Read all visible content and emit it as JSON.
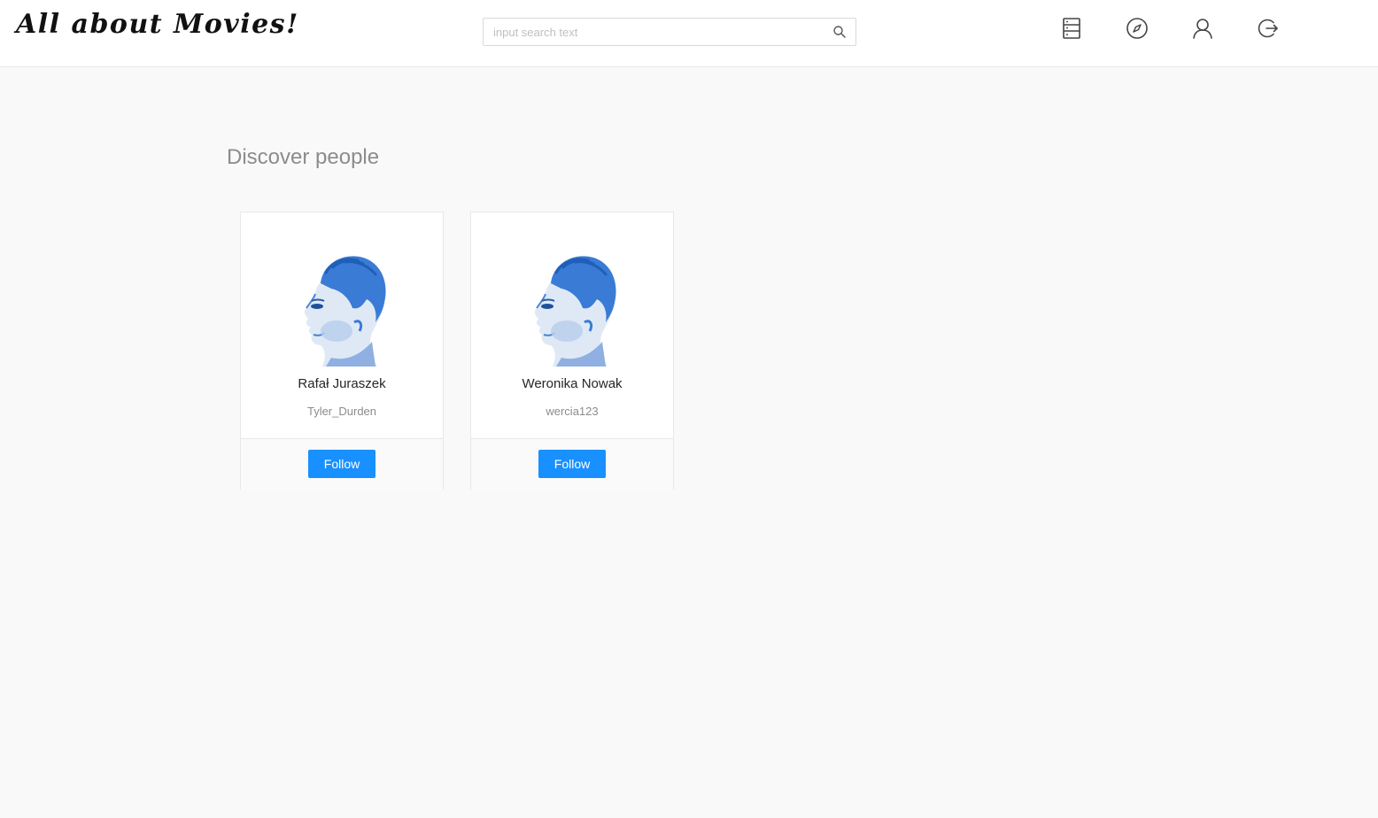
{
  "app": {
    "logo": "All about Movies!"
  },
  "search": {
    "placeholder": "input search text",
    "value": ""
  },
  "nav": {
    "icons": [
      "film-list-icon",
      "compass-icon",
      "user-icon",
      "logout-icon"
    ]
  },
  "main": {
    "title": "Discover people",
    "people": [
      {
        "name": "Rafał Juraszek",
        "username": "Tyler_Durden",
        "follow_label": "Follow"
      },
      {
        "name": "Weronika Nowak",
        "username": "wercia123",
        "follow_label": "Follow"
      }
    ]
  },
  "colors": {
    "primary": "#1890ff",
    "avatar_blue": "#3a7bd5"
  }
}
